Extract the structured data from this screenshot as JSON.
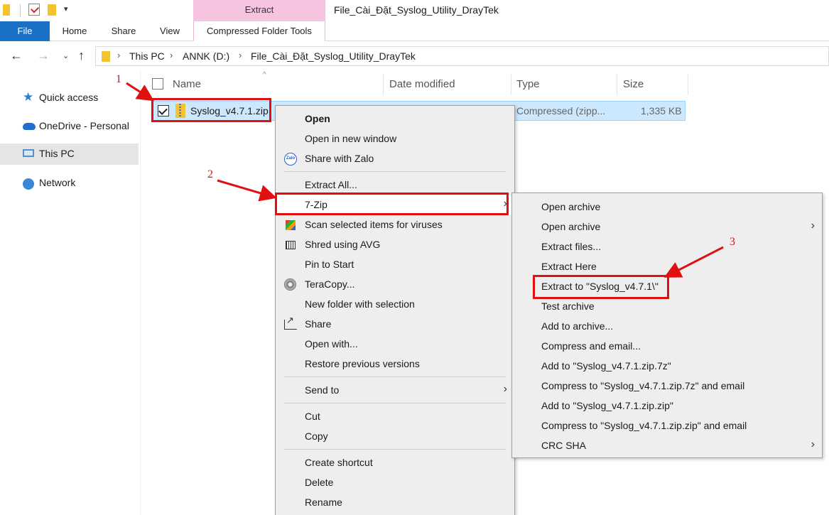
{
  "window": {
    "title": "File_Cài_Đặt_Syslog_Utility_DrayTek",
    "context_tab_header": "Extract"
  },
  "ribbon": {
    "tabs": [
      "File",
      "Home",
      "Share",
      "View",
      "Compressed Folder Tools"
    ]
  },
  "address": {
    "breadcrumbs": [
      "This PC",
      "ANNK (D:)",
      "File_Cài_Đặt_Syslog_Utility_DrayTek"
    ]
  },
  "nav_pane": {
    "items": [
      {
        "label": "Quick access",
        "icon": "star-icon"
      },
      {
        "label": "OneDrive - Personal",
        "icon": "cloud-icon"
      },
      {
        "label": "This PC",
        "icon": "computer-icon",
        "selected": true
      },
      {
        "label": "Network",
        "icon": "network-icon"
      }
    ]
  },
  "columns": {
    "name": "Name",
    "date_modified": "Date modified",
    "type": "Type",
    "size": "Size"
  },
  "file": {
    "name": "Syslog_v4.7.1.zip",
    "type": "Compressed (zipp...",
    "size": "1,335 KB"
  },
  "context_menu": {
    "items": [
      "Open",
      "Open in new window",
      "Share with Zalo",
      "Extract All...",
      "7-Zip",
      "Scan selected items for viruses",
      "Shred using AVG",
      "Pin to Start",
      "TeraCopy...",
      "New folder with selection",
      "Share",
      "Open with...",
      "Restore previous versions",
      "Send to",
      "Cut",
      "Copy",
      "Create shortcut",
      "Delete",
      "Rename"
    ],
    "zalo_icon_text": "Zalo"
  },
  "submenu_7zip": {
    "items": [
      "Open archive",
      "Open archive",
      "Extract files...",
      "Extract Here",
      "Extract to \"Syslog_v4.7.1\\\"",
      "Test archive",
      "Add to archive...",
      "Compress and email...",
      "Add to \"Syslog_v4.7.1.zip.7z\"",
      "Compress to \"Syslog_v4.7.1.zip.7z\" and email",
      "Add to \"Syslog_v4.7.1.zip.zip\"",
      "Compress to \"Syslog_v4.7.1.zip.zip\" and email",
      "CRC SHA"
    ]
  },
  "annotations": {
    "step1": "1",
    "step2": "2",
    "step3": "3",
    "color": "#e01010"
  },
  "colors": {
    "file_tab": "#1a6fc7",
    "context_tab": "#f6c3e0",
    "selection": "#cce8ff",
    "menu_bg": "#eeeeee"
  }
}
